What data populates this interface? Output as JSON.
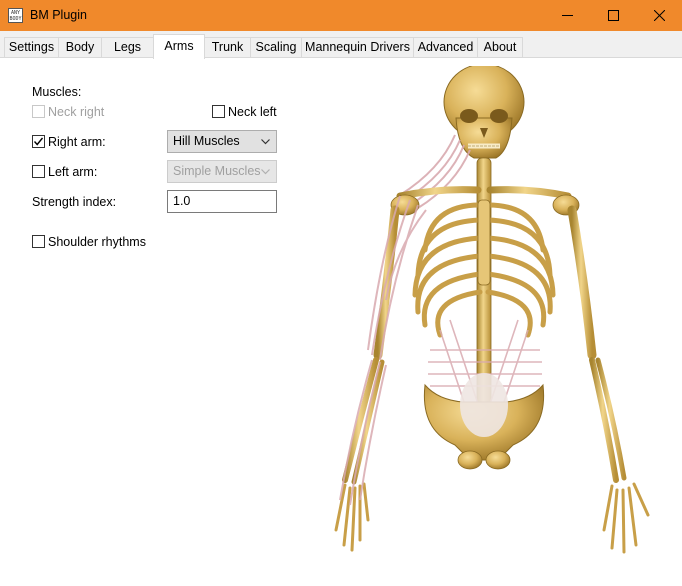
{
  "window": {
    "title": "BM Plugin",
    "app_icon_text": [
      "ANY",
      "BODY"
    ],
    "titlebar_color": "#f0892b"
  },
  "tabs": [
    {
      "label": "Settings",
      "active": false
    },
    {
      "label": "Body",
      "active": false
    },
    {
      "label": "Legs",
      "active": false
    },
    {
      "label": "Arms",
      "active": true
    },
    {
      "label": "Trunk",
      "active": false
    },
    {
      "label": "Scaling",
      "active": false
    },
    {
      "label": "Mannequin Drivers",
      "active": false
    },
    {
      "label": "Advanced",
      "active": false
    },
    {
      "label": "About",
      "active": false
    }
  ],
  "arms": {
    "muscles_label": "Muscles:",
    "neck_right": {
      "label": "Neck right",
      "checked": false,
      "enabled": false
    },
    "neck_left": {
      "label": "Neck left",
      "checked": false,
      "enabled": true
    },
    "right_arm": {
      "label": "Right arm:",
      "checked": true,
      "enabled": true,
      "selected": "Hill Muscles"
    },
    "left_arm": {
      "label": "Left arm:",
      "checked": false,
      "enabled": true,
      "selected": "Simple Muscles",
      "combo_enabled": false
    },
    "strength_index": {
      "label": "Strength index:",
      "value": "1.0"
    },
    "shoulder_rhythms": {
      "label": "Shoulder rhythms",
      "checked": false
    }
  },
  "illustration": {
    "subject": "human-skeleton-with-arm-muscles",
    "bone_color": "#d9b25a",
    "muscle_color": "#d9aab0"
  }
}
